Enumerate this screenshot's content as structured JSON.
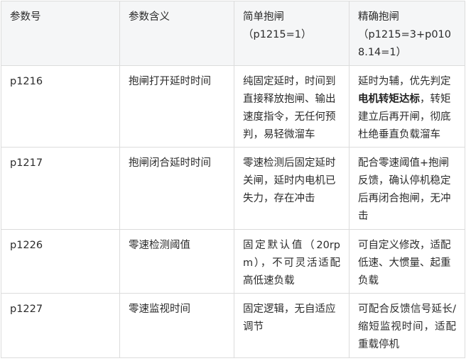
{
  "table": {
    "headers": {
      "param_no": "参数号",
      "param_meaning": "参数含义",
      "simple_brake": "简单抱闸\n（p1215=1）",
      "precise_brake": "精确抱闸\n（p1215=3+p0108.14=1）"
    },
    "rows": [
      {
        "param": "p1216",
        "meaning": "抱闸打开延时时间",
        "simple": "纯固定延时，时间到直接释放抱闸、输出速度指令，无任何预判，易轻微溜车",
        "precise_prefix": "延时为辅，优先判定",
        "precise_bold": "电机转矩达标",
        "precise_suffix": "，转矩建立后再开闸，彻底杜绝垂直负载溜车"
      },
      {
        "param": "p1217",
        "meaning": "抱闸闭合延时时间",
        "simple": "零速检测后固定延时关闸，延时内电机已失力，存在冲击",
        "precise": "配合零速阈值+抱闸反馈，确认停机稳定后再闭合抱闸，无冲击"
      },
      {
        "param": "p1226",
        "meaning": "零速检测阈值",
        "simple": "固定默认值（20rpm），不可灵活适配高低速负载",
        "precise": "可自定义修改，适配低速、大惯量、起重负载"
      },
      {
        "param": "p1227",
        "meaning": "零速监视时间",
        "simple": "固定逻辑，无自适应调节",
        "precise": "可配合反馈信号延长/缩短监视时间，适配重载停机"
      }
    ]
  }
}
